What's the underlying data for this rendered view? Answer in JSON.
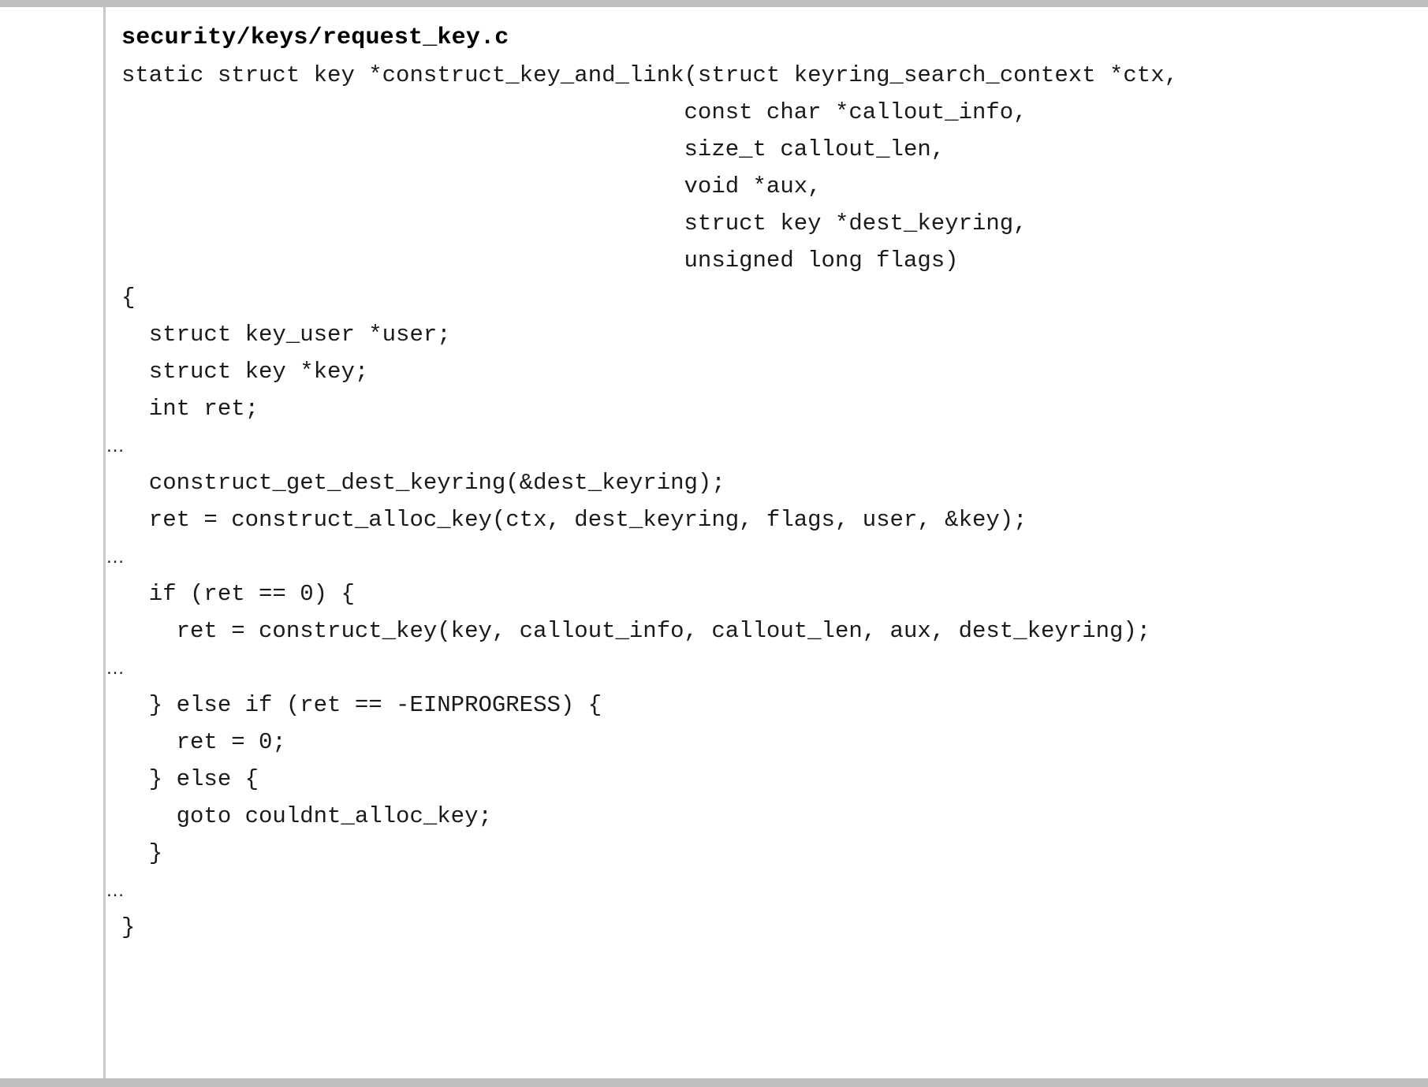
{
  "slide": {
    "file_title": "security/keys/request_key.c",
    "divider_color": "#c9c9c9",
    "rule_color": "#bfbfbf",
    "text_color": "#1a1a1a",
    "ellipsis_marker": "…",
    "code_lines": [
      {
        "kind": "code",
        "text": "static struct key *construct_key_and_link(struct keyring_search_context *ctx,"
      },
      {
        "kind": "code",
        "text": "                                         const char *callout_info,"
      },
      {
        "kind": "code",
        "text": "                                         size_t callout_len,"
      },
      {
        "kind": "code",
        "text": "                                         void *aux,"
      },
      {
        "kind": "code",
        "text": "                                         struct key *dest_keyring,"
      },
      {
        "kind": "code",
        "text": "                                         unsigned long flags)"
      },
      {
        "kind": "code",
        "text": "{"
      },
      {
        "kind": "code",
        "text": "  struct key_user *user;"
      },
      {
        "kind": "code",
        "text": "  struct key *key;"
      },
      {
        "kind": "code",
        "text": "  int ret;"
      },
      {
        "kind": "ellipsis",
        "text": "…"
      },
      {
        "kind": "code",
        "text": "  construct_get_dest_keyring(&dest_keyring);"
      },
      {
        "kind": "code",
        "text": "  ret = construct_alloc_key(ctx, dest_keyring, flags, user, &key);"
      },
      {
        "kind": "ellipsis",
        "text": "…"
      },
      {
        "kind": "code",
        "text": "  if (ret == 0) {"
      },
      {
        "kind": "code",
        "text": "    ret = construct_key(key, callout_info, callout_len, aux, dest_keyring);"
      },
      {
        "kind": "ellipsis",
        "text": "…"
      },
      {
        "kind": "code",
        "text": "  } else if (ret == -EINPROGRESS) {"
      },
      {
        "kind": "code",
        "text": "    ret = 0;"
      },
      {
        "kind": "code",
        "text": "  } else {"
      },
      {
        "kind": "code",
        "text": "    goto couldnt_alloc_key;"
      },
      {
        "kind": "code",
        "text": "  }"
      },
      {
        "kind": "ellipsis",
        "text": "…"
      },
      {
        "kind": "code",
        "text": "}"
      }
    ]
  }
}
